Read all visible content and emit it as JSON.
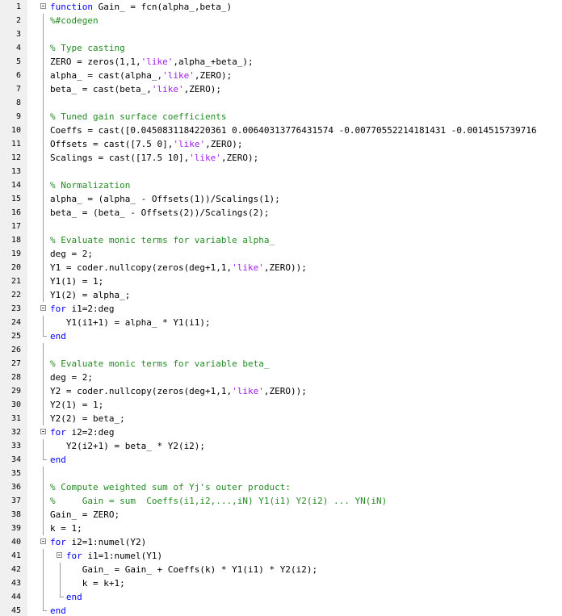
{
  "colors": {
    "keyword": "#0000ff",
    "comment": "#228b22",
    "string": "#a020f0",
    "text": "#000000",
    "gutter": "#f0f0f0"
  },
  "lines": [
    {
      "n": "1",
      "fold": "box",
      "tokens": [
        {
          "t": "kw",
          "v": "function"
        },
        {
          "t": "plain",
          "v": " Gain_ = fcn(alpha_,beta_)"
        }
      ]
    },
    {
      "n": "2",
      "fold": "line",
      "tokens": [
        {
          "t": "cm",
          "v": "%#codegen"
        }
      ]
    },
    {
      "n": "3",
      "fold": "line",
      "tokens": []
    },
    {
      "n": "4",
      "fold": "line",
      "tokens": [
        {
          "t": "cm",
          "v": "% Type casting"
        }
      ]
    },
    {
      "n": "5",
      "fold": "line",
      "tokens": [
        {
          "t": "plain",
          "v": "ZERO = zeros(1,1,"
        },
        {
          "t": "str",
          "v": "'like'"
        },
        {
          "t": "plain",
          "v": ",alpha_+beta_);"
        }
      ]
    },
    {
      "n": "6",
      "fold": "line",
      "tokens": [
        {
          "t": "plain",
          "v": "alpha_ = cast(alpha_,"
        },
        {
          "t": "str",
          "v": "'like'"
        },
        {
          "t": "plain",
          "v": ",ZERO);"
        }
      ]
    },
    {
      "n": "7",
      "fold": "line",
      "tokens": [
        {
          "t": "plain",
          "v": "beta_ = cast(beta_,"
        },
        {
          "t": "str",
          "v": "'like'"
        },
        {
          "t": "plain",
          "v": ",ZERO);"
        }
      ]
    },
    {
      "n": "8",
      "fold": "line",
      "tokens": []
    },
    {
      "n": "9",
      "fold": "line",
      "tokens": [
        {
          "t": "cm",
          "v": "% Tuned gain surface coefficients"
        }
      ]
    },
    {
      "n": "10",
      "fold": "line",
      "tokens": [
        {
          "t": "plain",
          "v": "Coeffs = cast([0.0450831184220361 0.00640313776431574 -0.00770552214181431 -0.0014515739716"
        }
      ]
    },
    {
      "n": "11",
      "fold": "line",
      "tokens": [
        {
          "t": "plain",
          "v": "Offsets = cast([7.5 0],"
        },
        {
          "t": "str",
          "v": "'like'"
        },
        {
          "t": "plain",
          "v": ",ZERO);"
        }
      ]
    },
    {
      "n": "12",
      "fold": "line",
      "tokens": [
        {
          "t": "plain",
          "v": "Scalings = cast([17.5 10],"
        },
        {
          "t": "str",
          "v": "'like'"
        },
        {
          "t": "plain",
          "v": ",ZERO);"
        }
      ]
    },
    {
      "n": "13",
      "fold": "line",
      "tokens": []
    },
    {
      "n": "14",
      "fold": "line",
      "tokens": [
        {
          "t": "cm",
          "v": "% Normalization"
        }
      ]
    },
    {
      "n": "15",
      "fold": "line",
      "tokens": [
        {
          "t": "plain",
          "v": "alpha_ = (alpha_ - Offsets(1))/Scalings(1);"
        }
      ]
    },
    {
      "n": "16",
      "fold": "line",
      "tokens": [
        {
          "t": "plain",
          "v": "beta_ = (beta_ - Offsets(2))/Scalings(2);"
        }
      ]
    },
    {
      "n": "17",
      "fold": "line",
      "tokens": []
    },
    {
      "n": "18",
      "fold": "line",
      "tokens": [
        {
          "t": "cm",
          "v": "% Evaluate monic terms for variable alpha_"
        }
      ]
    },
    {
      "n": "19",
      "fold": "line",
      "tokens": [
        {
          "t": "plain",
          "v": "deg = 2;"
        }
      ]
    },
    {
      "n": "20",
      "fold": "line",
      "tokens": [
        {
          "t": "plain",
          "v": "Y1 = coder.nullcopy(zeros(deg+1,1,"
        },
        {
          "t": "str",
          "v": "'like'"
        },
        {
          "t": "plain",
          "v": ",ZERO));"
        }
      ]
    },
    {
      "n": "21",
      "fold": "line",
      "tokens": [
        {
          "t": "plain",
          "v": "Y1(1) = 1;"
        }
      ]
    },
    {
      "n": "22",
      "fold": "line",
      "tokens": [
        {
          "t": "plain",
          "v": "Y1(2) = alpha_;"
        }
      ]
    },
    {
      "n": "23",
      "fold": "box",
      "tokens": [
        {
          "t": "kw",
          "v": "for"
        },
        {
          "t": "plain",
          "v": " i1=2:deg"
        }
      ]
    },
    {
      "n": "24",
      "fold": "line",
      "tokens": [
        {
          "t": "plain",
          "v": "   Y1(i1+1) = alpha_ * Y1(i1);"
        }
      ]
    },
    {
      "n": "25",
      "fold": "end",
      "tokens": [
        {
          "t": "kw",
          "v": "end"
        }
      ]
    },
    {
      "n": "26",
      "fold": "line",
      "tokens": []
    },
    {
      "n": "27",
      "fold": "line",
      "tokens": [
        {
          "t": "cm",
          "v": "% Evaluate monic terms for variable beta_"
        }
      ]
    },
    {
      "n": "28",
      "fold": "line",
      "tokens": [
        {
          "t": "plain",
          "v": "deg = 2;"
        }
      ]
    },
    {
      "n": "29",
      "fold": "line",
      "tokens": [
        {
          "t": "plain",
          "v": "Y2 = coder.nullcopy(zeros(deg+1,1,"
        },
        {
          "t": "str",
          "v": "'like'"
        },
        {
          "t": "plain",
          "v": ",ZERO));"
        }
      ]
    },
    {
      "n": "30",
      "fold": "line",
      "tokens": [
        {
          "t": "plain",
          "v": "Y2(1) = 1;"
        }
      ]
    },
    {
      "n": "31",
      "fold": "line",
      "tokens": [
        {
          "t": "plain",
          "v": "Y2(2) = beta_;"
        }
      ]
    },
    {
      "n": "32",
      "fold": "box",
      "tokens": [
        {
          "t": "kw",
          "v": "for"
        },
        {
          "t": "plain",
          "v": " i2=2:deg"
        }
      ]
    },
    {
      "n": "33",
      "fold": "line",
      "tokens": [
        {
          "t": "plain",
          "v": "   Y2(i2+1) = beta_ * Y2(i2);"
        }
      ]
    },
    {
      "n": "34",
      "fold": "end",
      "tokens": [
        {
          "t": "kw",
          "v": "end"
        }
      ]
    },
    {
      "n": "35",
      "fold": "line",
      "tokens": []
    },
    {
      "n": "36",
      "fold": "line",
      "tokens": [
        {
          "t": "cm",
          "v": "% Compute weighted sum of Yj's outer product:"
        }
      ]
    },
    {
      "n": "37",
      "fold": "line",
      "tokens": [
        {
          "t": "cm",
          "v": "%     Gain = sum  Coeffs(i1,i2,...,iN) Y1(i1) Y2(i2) ... YN(iN)"
        }
      ]
    },
    {
      "n": "38",
      "fold": "line",
      "tokens": [
        {
          "t": "plain",
          "v": "Gain_ = ZERO;"
        }
      ]
    },
    {
      "n": "39",
      "fold": "line",
      "tokens": [
        {
          "t": "plain",
          "v": "k = 1;"
        }
      ]
    },
    {
      "n": "40",
      "fold": "box",
      "tokens": [
        {
          "t": "kw",
          "v": "for"
        },
        {
          "t": "plain",
          "v": " i2=1:numel(Y2)"
        }
      ]
    },
    {
      "n": "41",
      "fold": "box2",
      "tokens": [
        {
          "t": "plain",
          "v": "   "
        },
        {
          "t": "kw",
          "v": "for"
        },
        {
          "t": "plain",
          "v": " i1=1:numel(Y1)"
        }
      ]
    },
    {
      "n": "42",
      "fold": "line",
      "tokens": [
        {
          "t": "plain",
          "v": "      Gain_ = Gain_ + Coeffs(k) * Y1(i1) * Y2(i2);"
        }
      ]
    },
    {
      "n": "43",
      "fold": "line",
      "tokens": [
        {
          "t": "plain",
          "v": "      k = k+1;"
        }
      ]
    },
    {
      "n": "44",
      "fold": "end2",
      "tokens": [
        {
          "t": "plain",
          "v": "   "
        },
        {
          "t": "kw",
          "v": "end"
        }
      ]
    },
    {
      "n": "45",
      "fold": "end",
      "tokens": [
        {
          "t": "kw",
          "v": "end"
        }
      ]
    }
  ]
}
